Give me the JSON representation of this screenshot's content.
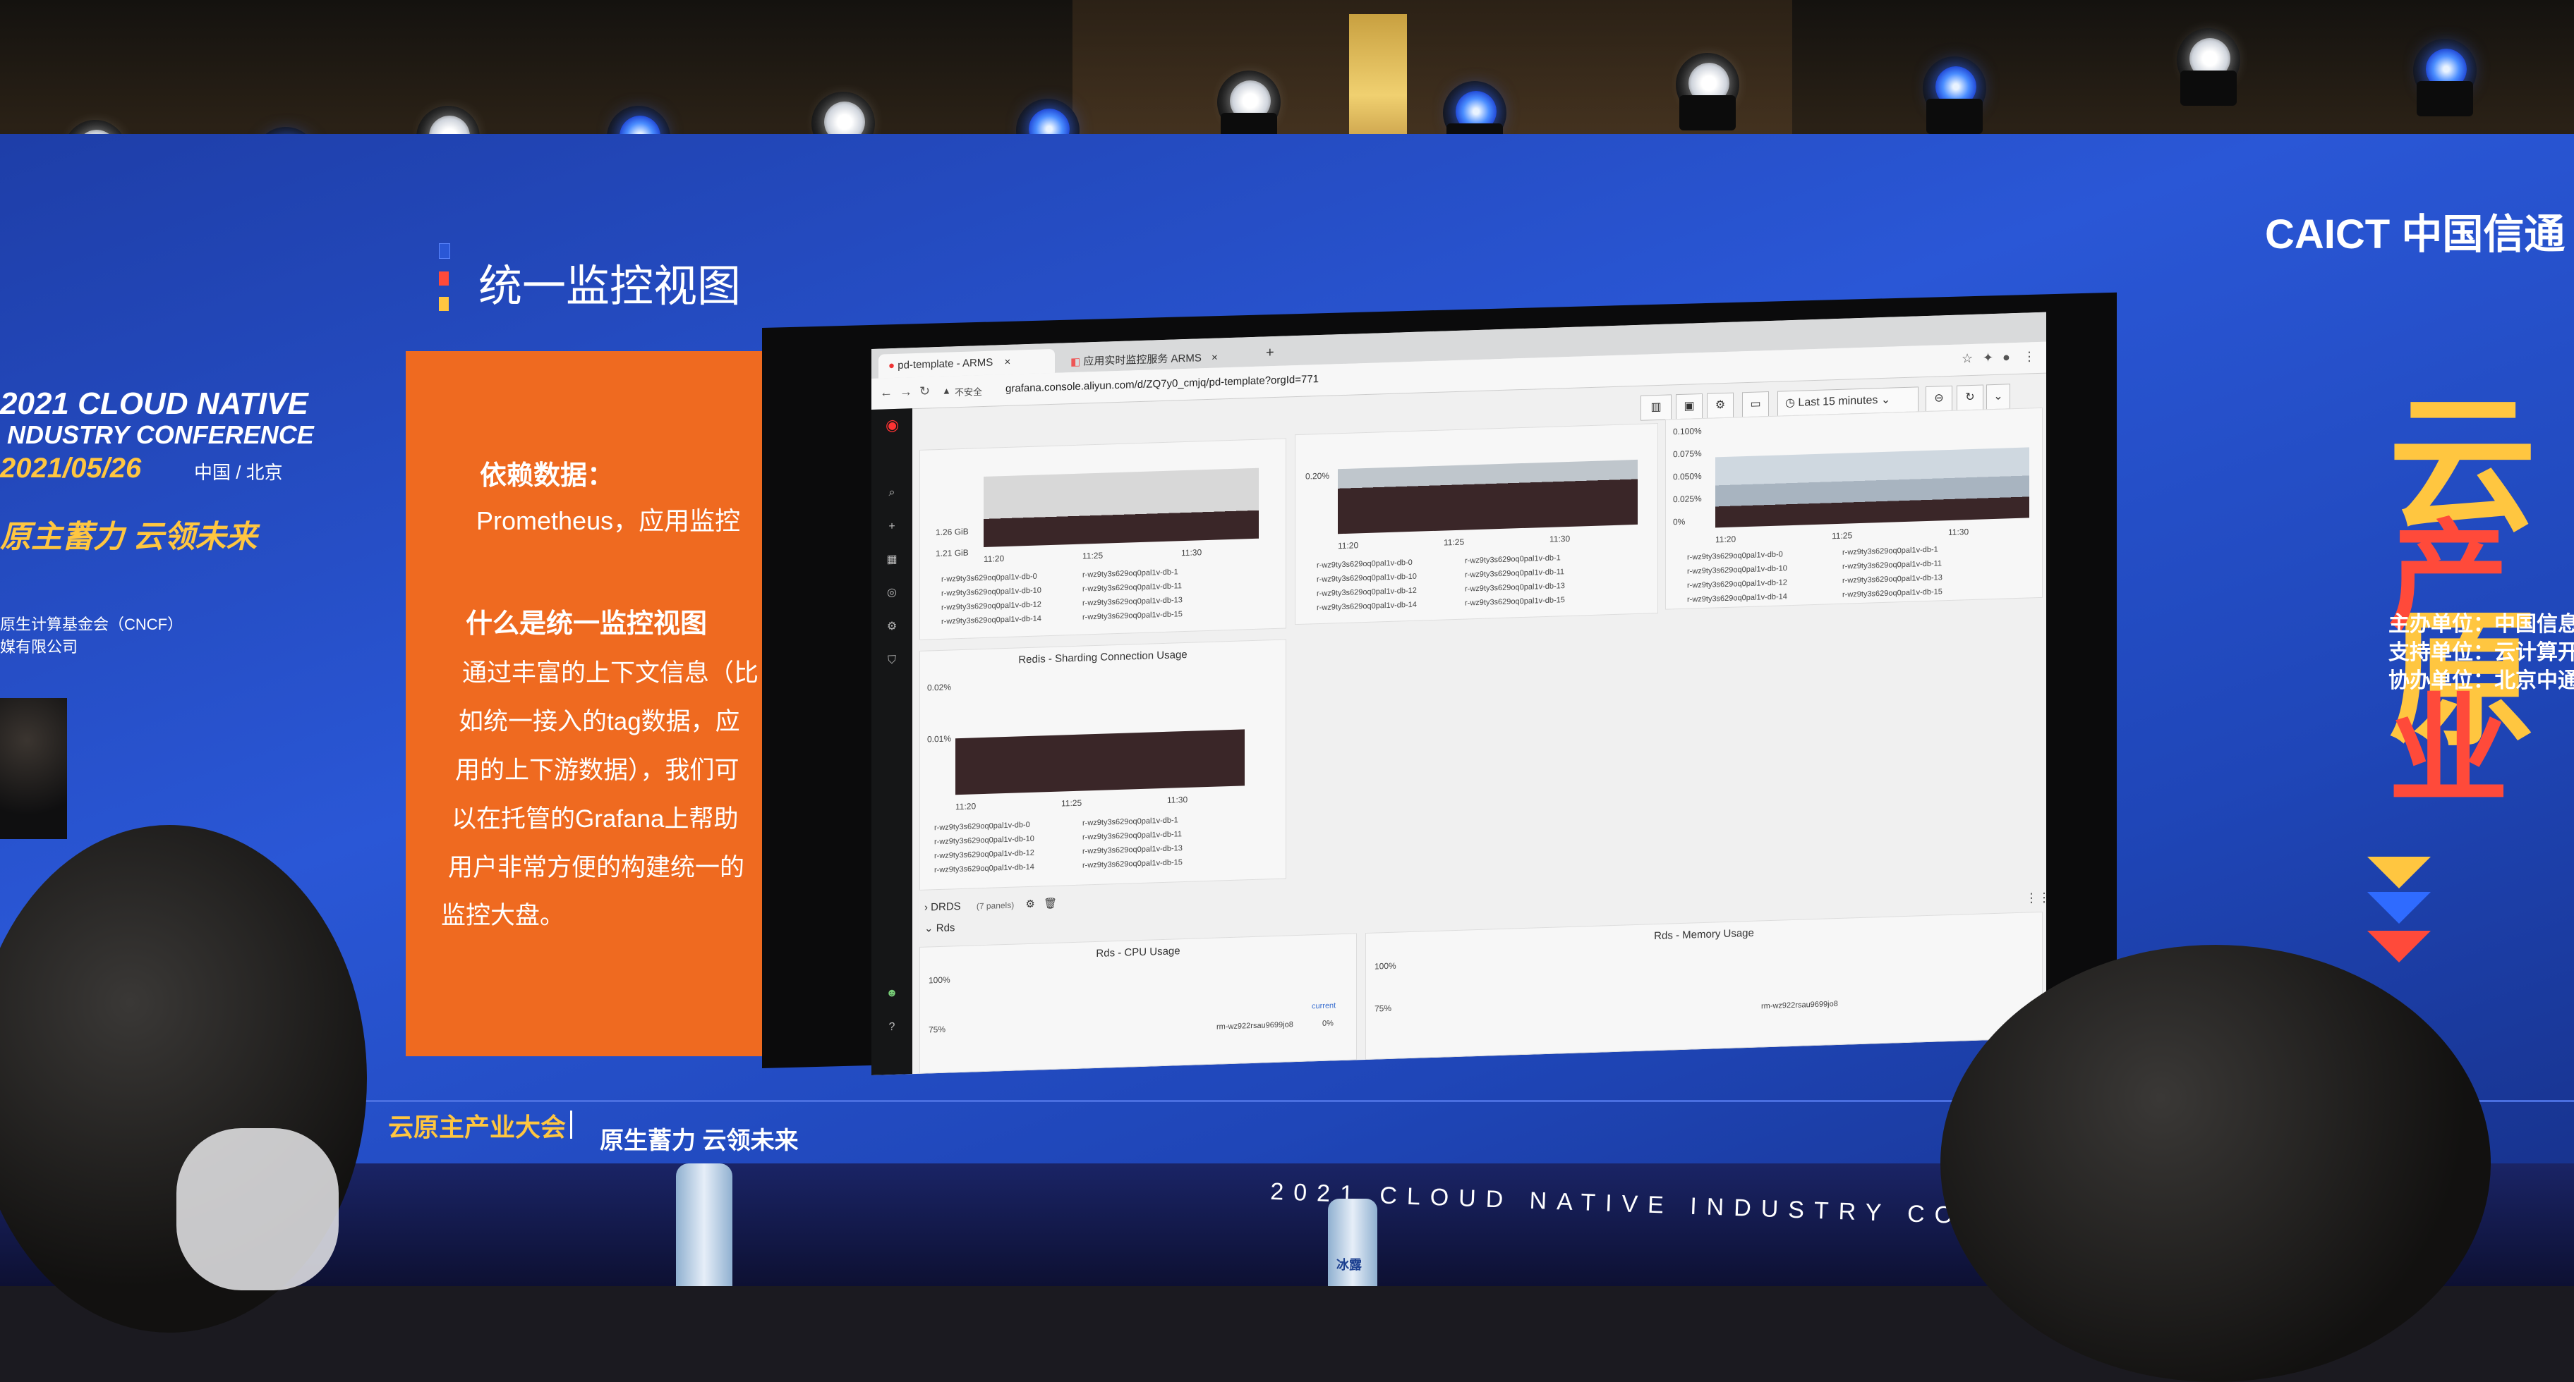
{
  "stage": {
    "conference_en_line1": "2021 CLOUD NATIVE",
    "conference_en_line2": "NDUSTRY CONFERENCE",
    "conference_date": "2021/05/26",
    "conference_location": "中国 / 北京",
    "slogan_left": "原主蓄力 云领未来",
    "org_line1": "原生计算基金会（CNCF）",
    "org_line2": "媒有限公司",
    "bottom_name": "云原主产业大会",
    "bottom_slogan": "原生蓄力 云领未来",
    "bottom_scroll": "2021 CLOUD NATIVE INDUSTRY CONFE",
    "right_logo_en": "CAICT",
    "right_logo_cn": "中国信通",
    "right_big1": "云原",
    "right_big2": "产业",
    "right_info": [
      "主办单位：中国信息",
      "支持单位：云计算开",
      "协办单位：北京中通"
    ],
    "bottle_label": "冰露"
  },
  "slide": {
    "title": "统一监控视图",
    "card_heading1": "依赖数据：",
    "card_text1": "Prometheus，应用监控",
    "card_heading2": "什么是统一监控视图",
    "card_body": [
      "通过丰富的上下文信息（比",
      "如统一接入的tag数据，应",
      "用的上下游数据），我们可",
      "以在托管的Grafana上帮助",
      "用户非常方便的构建统一的",
      "监控大盘。"
    ]
  },
  "browser": {
    "tab1": "pd-template - ARMS",
    "tab2": "应用实时监控服务 ARMS",
    "new_tab": "+",
    "not_secure": "不安全",
    "url": "grafana.console.aliyun.com/d/ZQ7y0_cmjq/pd-template?orgId=771",
    "time_range": "Last 15 minutes"
  },
  "grafana": {
    "panel_redis_connection": "Redis - Sharding Connection Usage",
    "row_drds": "DRDS",
    "row_drds_count": "(7 panels)",
    "row_rds": "Rds",
    "panel_cpu": "Rds - CPU Usage",
    "panel_memory": "Rds - Memory Usage",
    "cpu_legend_header": "current",
    "cpu_series": "rm-wz922rsau9699jo8",
    "cpu_current": "0%",
    "mem_series": "rm-wz922rsau9699jo8",
    "y_ticks_panel1": [
      "1.26 GiB",
      "1.21 GiB"
    ],
    "y_ticks_panel2": [
      "0.20%"
    ],
    "y_ticks_panel3": [
      "0.100%",
      "0.075%",
      "0.050%",
      "0.025%",
      "0%"
    ],
    "y_ticks_redis": [
      "0.02%",
      "0.01%"
    ],
    "y_ticks_cpu": [
      "100%",
      "75%"
    ],
    "y_ticks_mem": [
      "100%",
      "75%"
    ],
    "x_ticks": [
      "11:20",
      "11:25",
      "11:30"
    ],
    "legend_series": [
      "r-wz9ty3s629oq0pal1v-db-0",
      "r-wz9ty3s629oq0pal1v-db-1",
      "r-wz9ty3s629oq0pal1v-db-10",
      "r-wz9ty3s629oq0pal1v-db-11",
      "r-wz9ty3s629oq0pal1v-db-12",
      "r-wz9ty3s629oq0pal1v-db-13",
      "r-wz9ty3s629oq0pal1v-db-14",
      "r-wz9ty3s629oq0pal1v-db-15"
    ]
  },
  "colors": {
    "backdrop_blue": "#2a57d6",
    "card_orange": "#ef6a20",
    "accent_yellow": "#ffc640",
    "accent_red": "#ff4a3a",
    "grafana_sidebar": "#151617",
    "series_dark": "#3a2628"
  }
}
